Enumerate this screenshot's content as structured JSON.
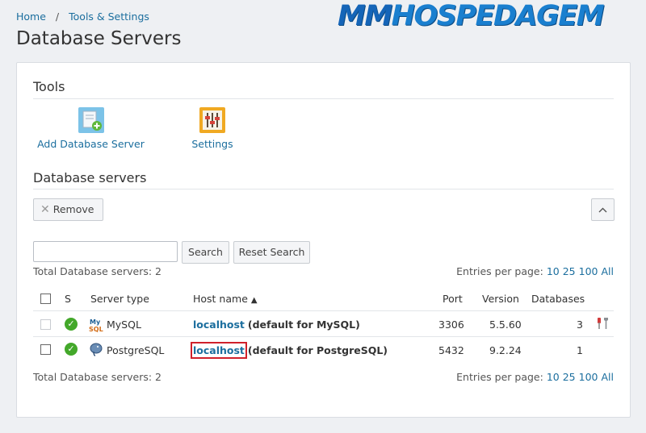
{
  "breadcrumb": {
    "home": "Home",
    "separator": "/",
    "current": "Tools & Settings"
  },
  "page_title": "Database Servers",
  "logo": {
    "part1": "MM",
    "part2": "HOSPEDAGEM"
  },
  "tools": {
    "title": "Tools",
    "add_server": {
      "label": "Add Database Server",
      "icon": "add-database-icon"
    },
    "settings": {
      "label": "Settings",
      "icon": "settings-sliders-icon"
    }
  },
  "servers": {
    "title": "Database servers",
    "remove_label": "Remove",
    "collapse_icon": "chevron-up-icon",
    "search": {
      "value": "",
      "placeholder": "",
      "search_label": "Search",
      "reset_label": "Reset Search"
    },
    "total_label": "Total Database servers: 2",
    "entries_label": "Entries per page:",
    "entries_options": [
      "10",
      "25",
      "100",
      "All"
    ],
    "columns": {
      "s": "S",
      "server_type": "Server type",
      "host_name": "Host name",
      "sort_indicator": "▲",
      "port": "Port",
      "version": "Version",
      "databases": "Databases"
    },
    "rows": [
      {
        "type": "MySQL",
        "type_icon": "mysql-logo-icon",
        "status_icon": "ok-check-icon",
        "host": "localhost",
        "host_note": "(default for MySQL)",
        "port": "3306",
        "version": "5.5.60",
        "databases": "3",
        "checkbox_enabled": false,
        "has_tools_icon": true
      },
      {
        "type": "PostgreSQL",
        "type_icon": "postgresql-elephant-icon",
        "status_icon": "ok-check-icon",
        "host": "localhost",
        "host_note": "(default for PostgreSQL)",
        "port": "5432",
        "version": "9.2.24",
        "databases": "1",
        "checkbox_enabled": true,
        "has_tools_icon": false
      }
    ],
    "footer_total_label": "Total Database servers: 2"
  }
}
